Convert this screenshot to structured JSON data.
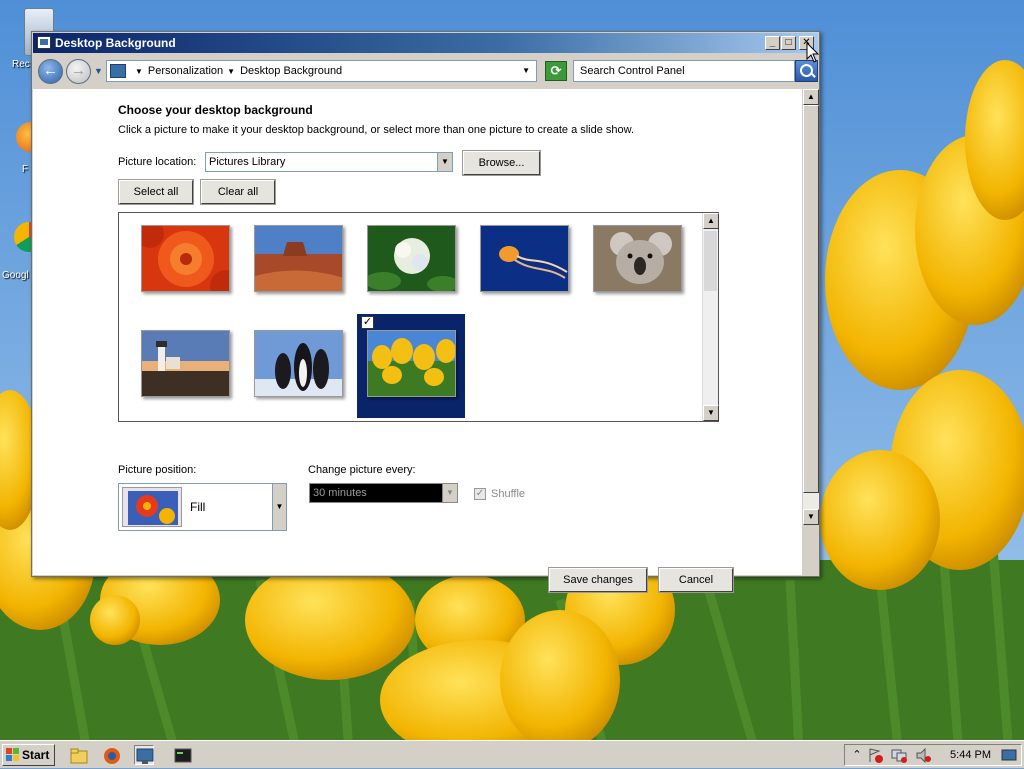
{
  "desktop": {
    "icons": [
      {
        "label": "Rec",
        "name": "recycle-bin"
      },
      {
        "label": "F",
        "name": "firefox-shortcut"
      },
      {
        "label": "Googl",
        "name": "google-chrome-shortcut"
      }
    ]
  },
  "window": {
    "title": "Desktop Background",
    "caption_buttons": {
      "minimize": "_",
      "maximize": "□",
      "close": "✕"
    }
  },
  "address_bar": {
    "breadcrumb": [
      "Personalization",
      "Desktop Background"
    ],
    "search_placeholder": "Search Control Panel"
  },
  "main": {
    "heading": "Choose your desktop background",
    "instruction": "Click a picture to make it your desktop background, or select more than one picture to create a slide show.",
    "picture_location_label": "Picture location:",
    "picture_location_value": "Pictures Library",
    "browse_button": "Browse...",
    "select_all_button": "Select all",
    "clear_all_button": "Clear all",
    "pictures": [
      {
        "name": "Chrysanthemum",
        "selected": false,
        "icon": "red-flower"
      },
      {
        "name": "Desert",
        "selected": false,
        "icon": "desert"
      },
      {
        "name": "Hydrangeas",
        "selected": false,
        "icon": "white-flowers"
      },
      {
        "name": "Jellyfish",
        "selected": false,
        "icon": "jellyfish"
      },
      {
        "name": "Koala",
        "selected": false,
        "icon": "koala"
      },
      {
        "name": "Lighthouse",
        "selected": false,
        "icon": "lighthouse"
      },
      {
        "name": "Penguins",
        "selected": false,
        "icon": "penguins"
      },
      {
        "name": "Tulips",
        "selected": true,
        "icon": "yellow-tulips"
      }
    ],
    "picture_position_label": "Picture position:",
    "picture_position_value": "Fill",
    "change_picture_label": "Change picture every:",
    "change_picture_value": "30 minutes",
    "shuffle_label": "Shuffle",
    "shuffle_checked": true,
    "save_button": "Save changes",
    "cancel_button": "Cancel"
  },
  "taskbar": {
    "start_label": "Start",
    "clock": "5:44 PM"
  },
  "colors": {
    "title_bar": "#0a246a",
    "selection": "#0a246a",
    "taskbar": "#d4d0c8"
  }
}
